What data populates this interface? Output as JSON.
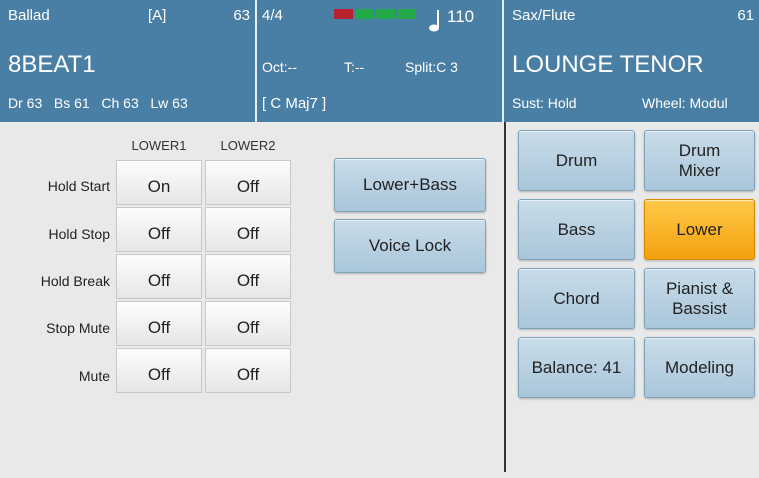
{
  "colors": {
    "header_bg": "#4a7fa5",
    "button_bg": "#b8d1e2",
    "active_bg": "#f8b32a",
    "beat_red": "#b7202e",
    "beat_green": "#23a94a"
  },
  "style_panel": {
    "style_name": "Ballad",
    "variation": "[A]",
    "tempo_value": "63",
    "title": "8BEAT1",
    "volumes": "Dr 63   Bs 61   Ch 63   Lw 63"
  },
  "center_panel": {
    "time_signature": "4/4",
    "tempo": "110",
    "octave": "Oct:--",
    "transpose": "T:--",
    "split": "Split:C 3",
    "chord": "[ C Maj7 ]",
    "beat_icon": "note-icon"
  },
  "voice_panel": {
    "category": "Sax/Flute",
    "number": "61",
    "voice_name": "LOUNGE TENOR",
    "sustain": "Sust: Hold",
    "wheel": "Wheel: Modul"
  },
  "table": {
    "columns": [
      "LOWER1",
      "LOWER2"
    ],
    "rows": [
      {
        "label": "Hold Start",
        "lower1": "On",
        "lower2": "Off"
      },
      {
        "label": "Hold Stop",
        "lower1": "Off",
        "lower2": "Off"
      },
      {
        "label": "Hold Break",
        "lower1": "Off",
        "lower2": "Off"
      },
      {
        "label": "Stop Mute",
        "lower1": "Off",
        "lower2": "Off"
      },
      {
        "label": "Mute",
        "lower1": "Off",
        "lower2": "Off"
      }
    ]
  },
  "center_buttons": {
    "lower_bass": "Lower+Bass",
    "voice_lock": "Voice Lock"
  },
  "right_buttons": {
    "drum": "Drum",
    "drum_mixer": "Drum\nMixer",
    "bass": "Bass",
    "lower": "Lower",
    "chord": "Chord",
    "pianist_bassist": "Pianist &\nBassist",
    "balance": "Balance: 41",
    "modeling": "Modeling"
  }
}
